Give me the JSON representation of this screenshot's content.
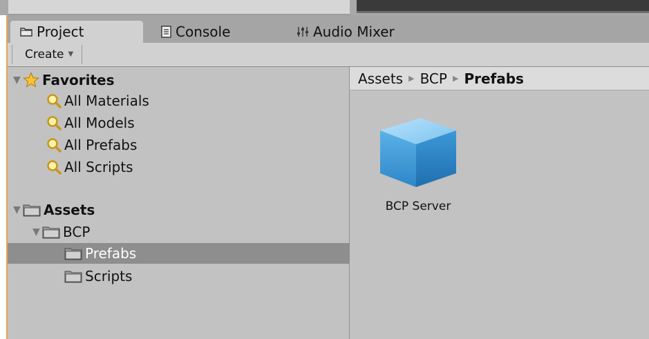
{
  "tabs": [
    {
      "label": "Project",
      "icon": "folder-icon",
      "active": true
    },
    {
      "label": "Console",
      "icon": "console-icon",
      "active": false
    },
    {
      "label": "Audio Mixer",
      "icon": "mixer-icon",
      "active": false
    }
  ],
  "toolbar": {
    "create_label": "Create"
  },
  "favorites": {
    "label": "Favorites",
    "items": [
      "All Materials",
      "All Models",
      "All Prefabs",
      "All Scripts"
    ]
  },
  "assets": {
    "label": "Assets",
    "bcp_label": "BCP",
    "children": [
      "Prefabs",
      "Scripts"
    ],
    "selected": "Prefabs"
  },
  "breadcrumb": [
    "Assets",
    "BCP",
    "Prefabs"
  ],
  "content": {
    "items": [
      {
        "label": "BCP Server",
        "icon": "prefab-cube-icon"
      }
    ]
  },
  "colors": {
    "selection": "#8e8e8e",
    "accent_edge": "#e8a451",
    "cube_blue": "#4aa3e0"
  }
}
